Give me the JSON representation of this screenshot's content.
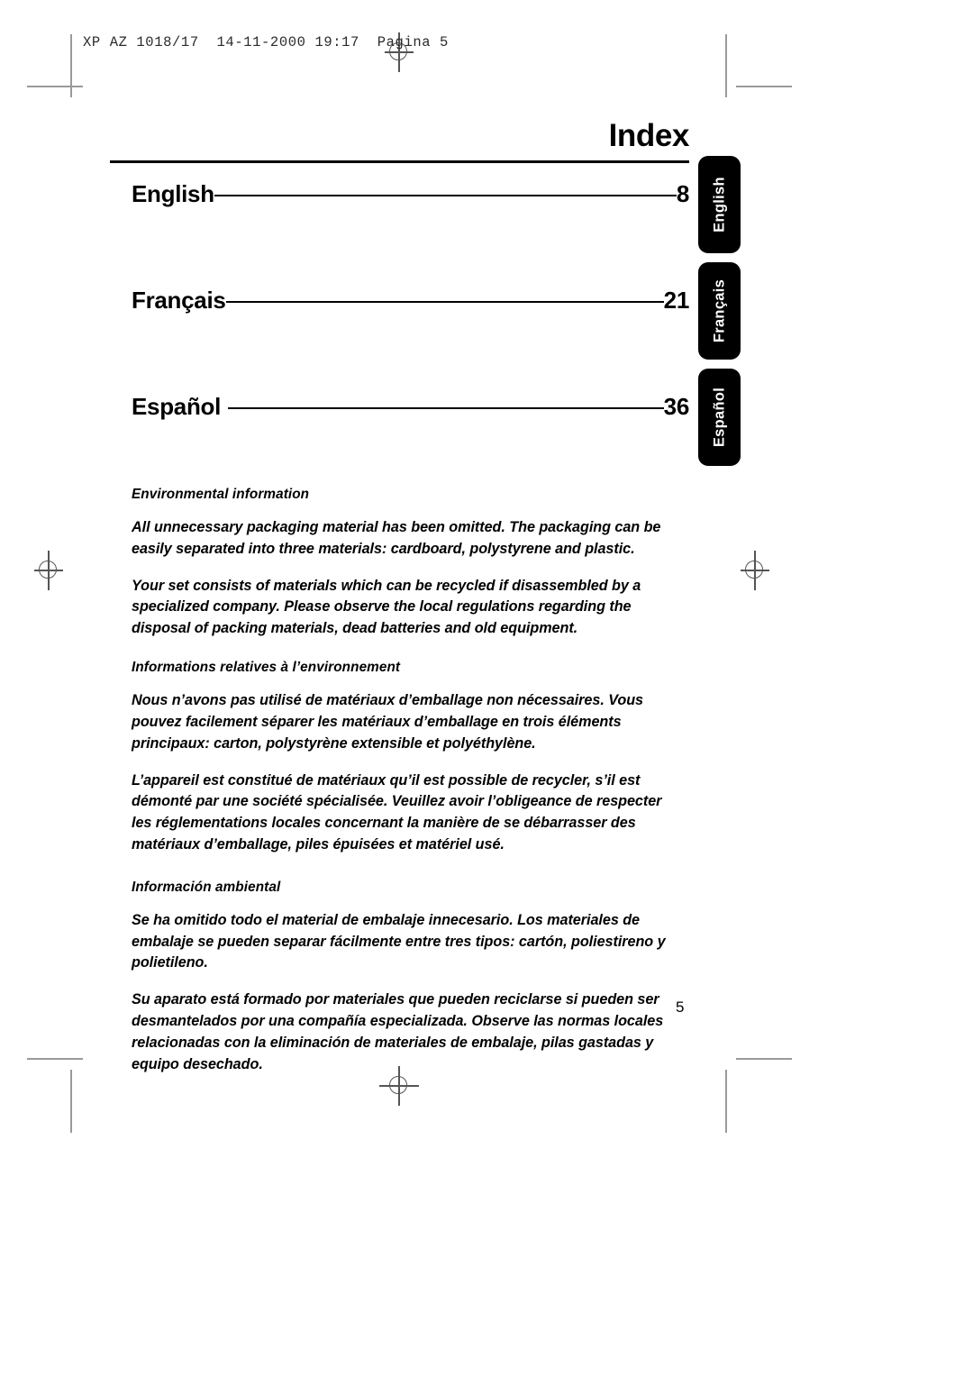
{
  "film_slug": "XP AZ 1018/17  14-11-2000 19:17  Pagina 5",
  "page": {
    "title": "Index",
    "folio": "5"
  },
  "index": {
    "entries": [
      {
        "language": "English",
        "page": "8"
      },
      {
        "language": "Français",
        "page": "21"
      },
      {
        "language": "Español",
        "page": "36"
      }
    ]
  },
  "side_tabs": [
    {
      "label": "English"
    },
    {
      "label": "Français"
    },
    {
      "label": "Español"
    }
  ],
  "environmental": {
    "english": {
      "heading": "Environmental information",
      "paragraphs": [
        "All unnecessary packaging material has been omitted. The packaging can be easily separated into three materials: cardboard, polystyrene and plastic.",
        "Your set consists of materials which can be recycled if disassembled by a specialized company. Please observe the local regulations regarding the disposal of packing materials, dead batteries and old equipment."
      ]
    },
    "french": {
      "heading": "Informations relatives à l’environnement",
      "paragraphs": [
        "Nous n’avons pas utilisé de matériaux d’emballage non nécessaires. Vous pouvez facilement séparer les matériaux d’emballage en trois éléments principaux: carton, polystyrène extensible et polyéthylène.",
        "L’appareil est constitué de matériaux qu’il est possible de recycler, s’il est démonté par une société spécialisée. Veuillez avoir l’obligeance de respecter les réglementations locales concernant la manière de se débarrasser des matériaux d’emballage, piles épuisées et matériel usé."
      ]
    },
    "spanish": {
      "heading": "Información ambiental",
      "paragraphs": [
        "Se ha omitido todo el material de embalaje innecesario. Los materiales de embalaje se pueden separar fácilmente entre tres tipos: cartón, poliestireno y polietileno.",
        "Su aparato está formado por materiales que pueden reciclarse si pueden ser desmantelados por una compañía especializada. Observe las normas locales relacionadas con la eliminación de materiales de embalaje, pilas gastadas y equipo desechado."
      ]
    }
  },
  "colors": {
    "ink": "#000000",
    "tab_background": "#000000",
    "tab_text": "#ffffff",
    "crop_mark": "#9a9a9a"
  }
}
